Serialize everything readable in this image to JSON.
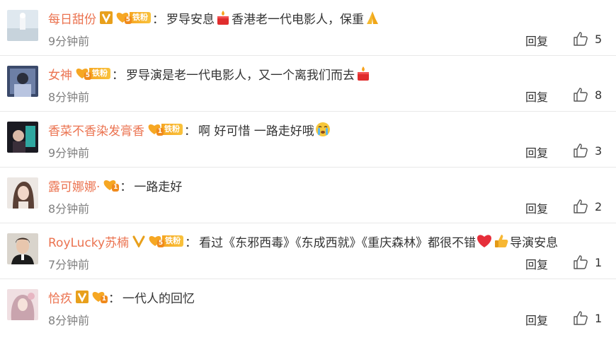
{
  "ui": {
    "reply_label": "回复",
    "fans_tag": "铁粉"
  },
  "comments": [
    {
      "username": "每日甜份",
      "verified": true,
      "fan_level": "5",
      "fan_tag": true,
      "text_before": "罗导安息",
      "emoji1": "candle-emoji",
      "text_after": "香港老一代电影人，保重",
      "emoji2": "pray-emoji",
      "text_tail": "",
      "emoji3": "",
      "text_end": "",
      "time": "9分钟前",
      "likes": "5"
    },
    {
      "username": "女神",
      "verified": false,
      "fan_level": "5",
      "fan_tag": true,
      "text_before": "罗导演是老一代电影人，又一个离我们而去",
      "emoji1": "candle-emoji",
      "text_after": "",
      "emoji2": "",
      "text_tail": "",
      "emoji3": "",
      "text_end": "",
      "time": "8分钟前",
      "likes": "8"
    },
    {
      "username": "香菜不香染发膏香",
      "verified": false,
      "fan_level": "1",
      "fan_tag": true,
      "text_before": "啊 好可惜 一路走好哦",
      "emoji1": "crying-emoji",
      "text_after": "",
      "emoji2": "",
      "text_tail": "",
      "emoji3": "",
      "text_end": "",
      "time": "9分钟前",
      "likes": "3"
    },
    {
      "username": "露可娜娜·",
      "verified": false,
      "fan_level": "1",
      "fan_tag": false,
      "text_before": "一路走好",
      "emoji1": "",
      "text_after": "",
      "emoji2": "",
      "text_tail": "",
      "emoji3": "",
      "text_end": "",
      "time": "8分钟前",
      "likes": "2"
    },
    {
      "username": "RoyLucky苏楠",
      "verified": true,
      "fan_level": "5",
      "fan_tag": true,
      "text_before": "看过《东邪西毒》《东成西就》《重庆森林》都很不错",
      "emoji1": "red-heart-emoji",
      "text_after": "",
      "emoji2": "thumbs-up-emoji",
      "text_tail": "导演安息",
      "emoji3": "",
      "text_end": "",
      "time": "7分钟前",
      "likes": "1"
    },
    {
      "username": "恰疚",
      "verified": true,
      "fan_level": "1",
      "fan_tag": false,
      "text_before": "一代人的回忆",
      "emoji1": "",
      "text_after": "",
      "emoji2": "",
      "text_tail": "",
      "emoji3": "",
      "text_end": "",
      "time": "8分钟前",
      "likes": "1"
    }
  ],
  "colors": {
    "username": "#eb7350",
    "meta": "#808080",
    "text": "#333333",
    "divider": "#e8e8e8",
    "fans_badge": "#f6a723",
    "verified": "#e8a01c"
  }
}
